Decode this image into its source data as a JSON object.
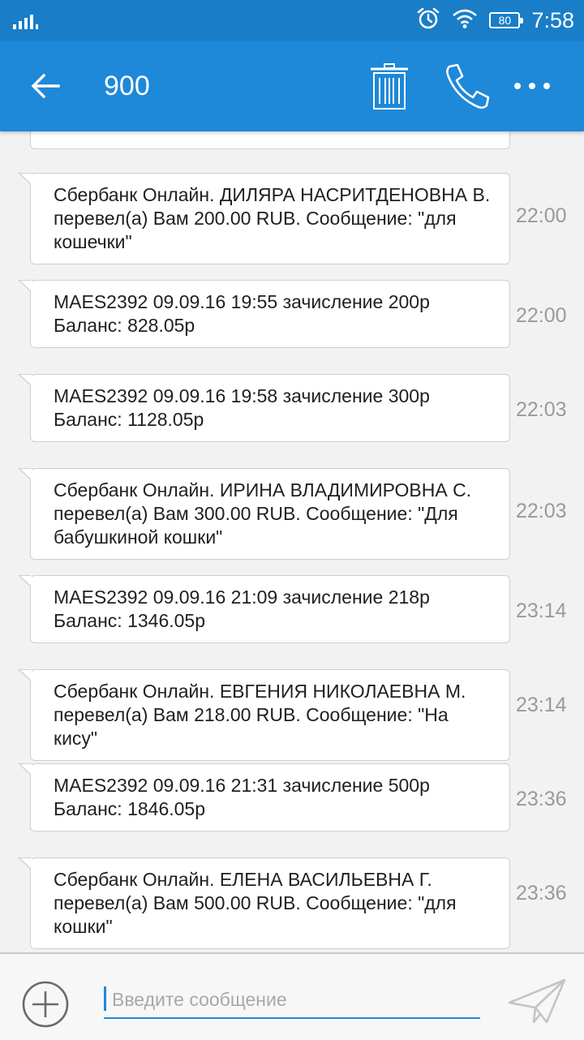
{
  "status_bar": {
    "battery": "80",
    "time": "7:58",
    "icons": [
      "signal-icon",
      "alarm-icon",
      "wifi-icon",
      "battery-icon"
    ]
  },
  "app_bar": {
    "title": "900",
    "icons": [
      "back-arrow-icon",
      "trash-icon",
      "phone-icon",
      "more-icon"
    ]
  },
  "messages": [
    {
      "text": "Сбербанк Онлайн. ДИЛЯРА НАСРИТДЕНОВНА В. перевел(а) Вам 200.00 RUB. Сообщение: \"для кошечки\"",
      "time": "22:00"
    },
    {
      "text": "MAES2392 09.09.16 19:55 зачисление 200р Баланс: 828.05р",
      "time": "22:00"
    },
    {
      "text": "MAES2392 09.09.16 19:58 зачисление 300р Баланс: 1128.05р",
      "time": "22:03"
    },
    {
      "text": "Сбербанк Онлайн. ИРИНА ВЛАДИМИРОВНА С. перевел(а) Вам 300.00 RUB. Сообщение: \"Для бабушкиной кошки\"",
      "time": "22:03"
    },
    {
      "text": "MAES2392 09.09.16 21:09 зачисление 218р Баланс: 1346.05р",
      "time": "23:14"
    },
    {
      "text": "Сбербанк Онлайн. ЕВГЕНИЯ НИКОЛАЕВНА М. перевел(а) Вам 218.00 RUB. Сообщение: \"На кису\"",
      "time": "23:14"
    },
    {
      "text": "MAES2392 09.09.16 21:31 зачисление 500р Баланс: 1846.05р",
      "time": "23:36"
    },
    {
      "text": "Сбербанк Онлайн. ЕЛЕНА ВАСИЛЬЕВНА Г. перевел(а) Вам 500.00 RUB. Сообщение: \"для кошки\"",
      "time": "23:36"
    }
  ],
  "composer": {
    "placeholder": "Введите сообщение",
    "icons": [
      "add-icon",
      "send-icon"
    ]
  },
  "colors": {
    "status_bar": "#1a7dc7",
    "app_bar": "#1e88d9",
    "background": "#f2f2f2",
    "time_text": "#9a9a9a"
  }
}
